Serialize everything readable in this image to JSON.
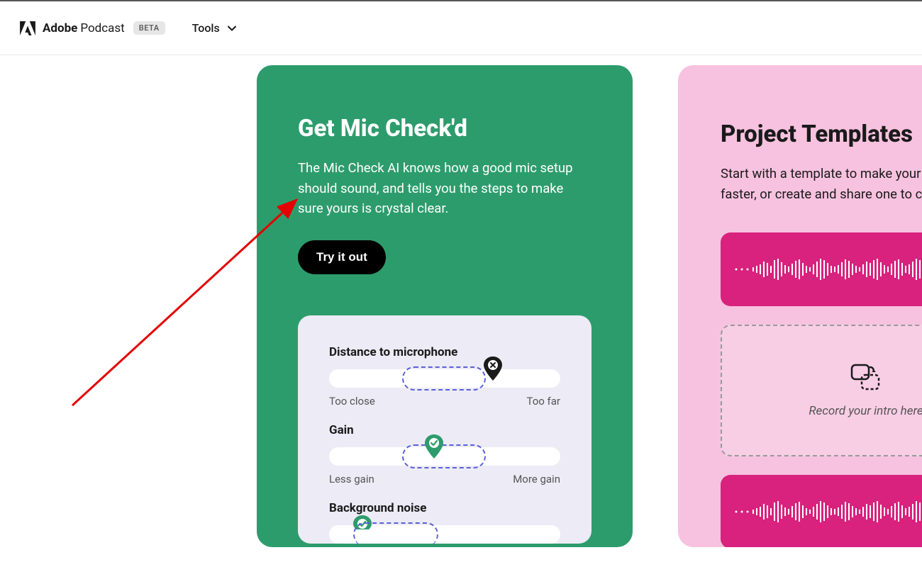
{
  "header": {
    "brand_strong": "Adobe",
    "brand_light": " Podcast",
    "beta": "BETA",
    "tools_label": "Tools"
  },
  "mic_card": {
    "title": "Get Mic Check'd",
    "desc": "The Mic Check AI knows how a good mic setup should sound, and tells you the steps to make sure yours is crystal clear.",
    "cta": "Try it out",
    "rows": {
      "distance": {
        "label": "Distance to microphone",
        "left": "Too close",
        "right": "Too far"
      },
      "gain": {
        "label": "Gain",
        "left": "Less gain",
        "right": "More gain"
      },
      "noise": {
        "label": "Background noise"
      }
    }
  },
  "templates_card": {
    "title": "Project Templates",
    "desc": "Start with a template to make your workflow faster, or create and share one to collaborate.",
    "placeholder": "Record your intro here"
  }
}
